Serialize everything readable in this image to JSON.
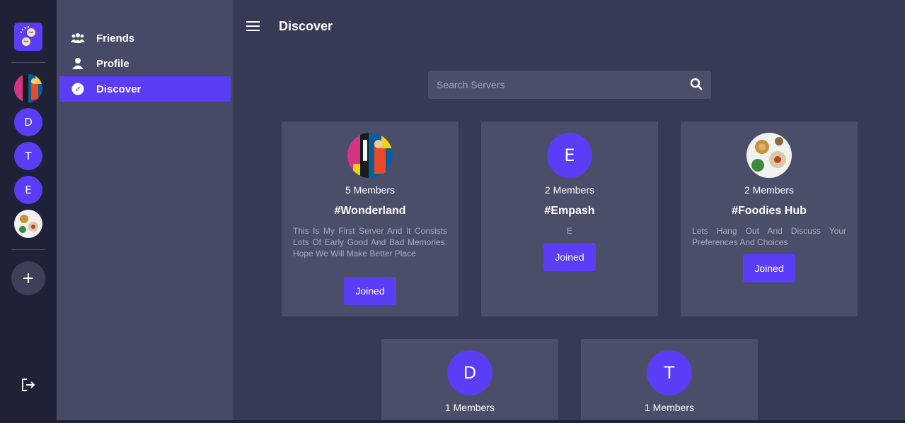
{
  "colors": {
    "accent": "#5b3df5",
    "rail_bg": "#1f2136",
    "nav_bg": "#464a66",
    "main_bg": "#363a55",
    "card_bg": "#4a4e69"
  },
  "rail": {
    "servers": [
      {
        "name": "wonderland",
        "letter": "",
        "icon": "graffiti-image"
      },
      {
        "name": "D",
        "letter": "D"
      },
      {
        "name": "T",
        "letter": "T"
      },
      {
        "name": "E",
        "letter": "E"
      },
      {
        "name": "foodies",
        "letter": "",
        "icon": "food-image"
      }
    ],
    "add_icon": "plus-icon",
    "logout_icon": "logout-icon"
  },
  "nav": {
    "items": [
      {
        "label": "Friends",
        "icon": "users-icon"
      },
      {
        "label": "Profile",
        "icon": "user-icon"
      },
      {
        "label": "Discover",
        "icon": "compass-icon",
        "active": true
      }
    ]
  },
  "main": {
    "title": "Discover",
    "search": {
      "placeholder": "Search Servers",
      "icon": "search-icon"
    },
    "cards": [
      {
        "avatar_letter": "",
        "avatar_image": "graffiti-image",
        "members": "5 Members",
        "name": "#Wonderland",
        "description": "This Is My First Server And It Consists Lots Of Early Good And Bad Memories. Hope We Will Make Better Place",
        "button": "Joined"
      },
      {
        "avatar_letter": "E",
        "members": "2 Members",
        "name": "#Empash",
        "description": "E",
        "button": "Joined"
      },
      {
        "avatar_letter": "",
        "avatar_image": "food-image",
        "members": "2 Members",
        "name": "#Foodies Hub",
        "description": "Lets Hang Out And Discuss Your Preferences And Choices",
        "button": "Joined"
      },
      {
        "avatar_letter": "D",
        "members": "1 Members",
        "name": "",
        "description": "",
        "button": ""
      },
      {
        "avatar_letter": "T",
        "members": "1 Members",
        "name": "",
        "description": "",
        "button": ""
      }
    ]
  }
}
